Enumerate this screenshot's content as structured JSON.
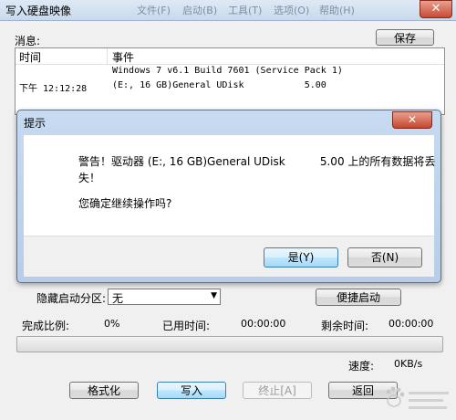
{
  "window": {
    "title": "写入硬盘映像",
    "ghost_menu": [
      "文件(F)",
      "启动(B)",
      "工具(T)",
      "选项(O)",
      "帮助(H)"
    ],
    "close_glyph": "✕"
  },
  "log": {
    "label": "消息:",
    "save_label": "保存",
    "columns": [
      "时间",
      "事件"
    ],
    "entries": [
      {
        "time": "",
        "event": "Windows 7 v6.1 Build 7601 (Service Pack 1)"
      },
      {
        "time": "下午 12:12:28",
        "event": "(E:, 16 GB)General UDisk           5.00"
      }
    ]
  },
  "dialog": {
    "title": "提示",
    "close_glyph": "✕",
    "warning_line1": "警告！驱动器 (E:, 16 GB)General UDisk          5.00 上的所有数据将丢",
    "warning_line2": "失！",
    "question": "您确定继续操作吗?",
    "yes_label": "是(Y)",
    "no_label": "否(N)"
  },
  "options": {
    "hidden_partition_label": "隐藏启动分区:",
    "hidden_partition_value": "无",
    "boot_button_label": "便捷启动"
  },
  "status": {
    "done_label": "完成比例:",
    "done_value": "0%",
    "elapsed_label": "已用时间:",
    "elapsed_value": "00:00:00",
    "remaining_label": "剩余时间:",
    "remaining_value": "00:00:00",
    "speed_label": "速度:",
    "speed_value": "0KB/s",
    "progress_fraction": 0,
    "progress_color": "#4cc24c"
  },
  "buttons": {
    "format": "格式化",
    "write": "写入",
    "stop": "终止[A]",
    "back": "返回"
  },
  "watermark_icon": "baidu-jingyan-watermark"
}
